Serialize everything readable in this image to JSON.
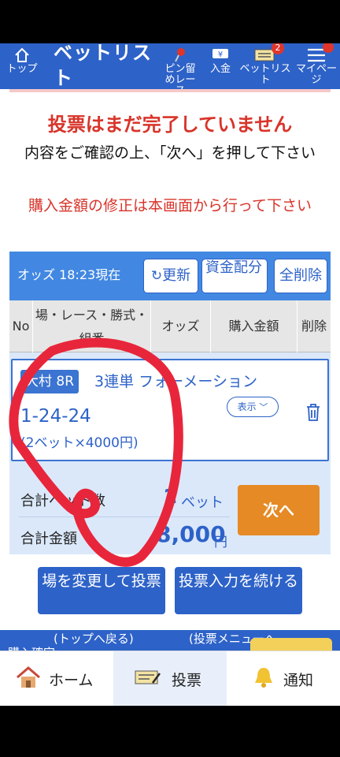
{
  "header": {
    "title": "ベットリスト",
    "top_label": "トップ",
    "pin_label": "ピン留めレース",
    "deposit_label": "入金",
    "betlist_label": "ベットリスト",
    "betlist_badge": "2",
    "mypage_label": "マイページ"
  },
  "messages": {
    "not_complete": "投票はまだ完了していません",
    "confirm": "内容をご確認の上、「次へ」を押して下さい",
    "modify_note": "購入金額の修正は本画面から行って下さい"
  },
  "odds_bar": {
    "label": "オッズ 18:23現在",
    "refresh": "更新",
    "allocate": "資金配分",
    "delete_all": "全削除"
  },
  "table": {
    "headers": [
      "No",
      "場・レース・勝式・組番",
      "オッズ",
      "購入金額",
      "削除"
    ]
  },
  "bet": {
    "venue_race": "大村 8R",
    "bet_type": "3連単 フォーメーション",
    "combination": "1-24-24",
    "detail": "(2ベット×4000円)",
    "display_toggle": "表示"
  },
  "summary": {
    "count_label": "合計ベット数",
    "count_value": "2",
    "count_unit": "ベット",
    "amount_label": "合計金額",
    "amount_value": "8,000",
    "amount_unit": "円",
    "next": "次へ"
  },
  "actions": {
    "change_venue": "場を変更して投票",
    "continue": "投票入力を続ける",
    "to_top": "(トップへ戻る)",
    "to_menu": "(投票メニューへ",
    "purchase_confirm": "購入確定"
  },
  "tabbar": {
    "home": "ホーム",
    "vote": "投票",
    "notify": "通知"
  },
  "colors": {
    "brand_blue": "#2d62c8",
    "odds_blue": "#4288e2",
    "warning_red": "#d8342a",
    "next_orange": "#e58a25",
    "annotation_red": "#e8263b"
  }
}
